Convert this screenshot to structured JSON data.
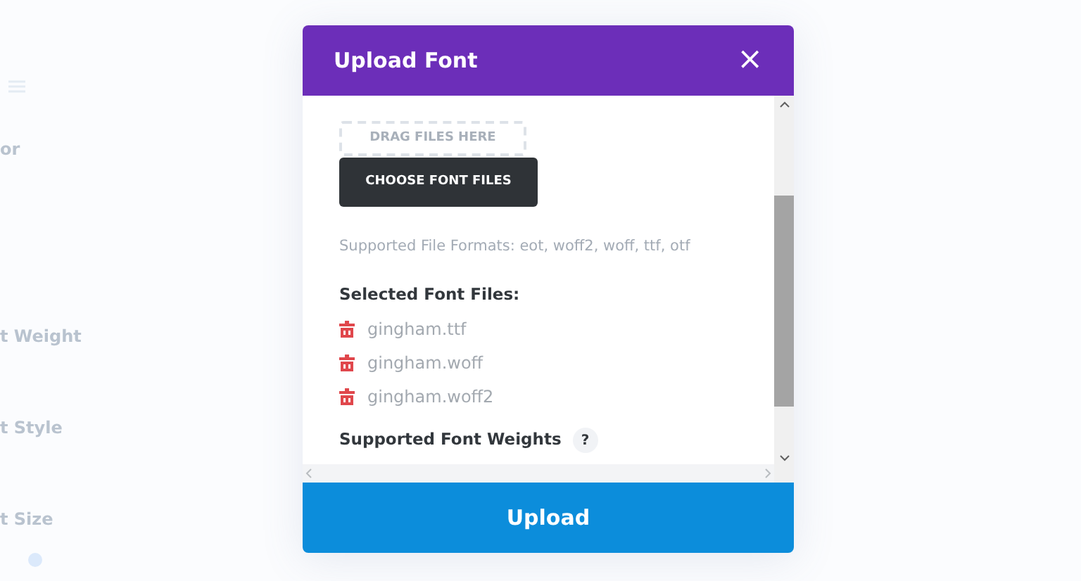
{
  "background": {
    "labels": [
      "or",
      "t Weight",
      "t Style",
      "t Size"
    ]
  },
  "dialog": {
    "title": "Upload Font",
    "close": "×",
    "drop_zone": "DRAG FILES HERE",
    "choose_button": "CHOOSE FONT FILES",
    "formats_note": "Supported File Formats: eot, woff2, woff, ttf, otf",
    "selected_heading": "Selected Font Files:",
    "files": [
      "gingham.ttf",
      "gingham.woff",
      "gingham.woff2"
    ],
    "weights_heading": "Supported Font Weights",
    "help": "?",
    "upload_button": "Upload"
  }
}
